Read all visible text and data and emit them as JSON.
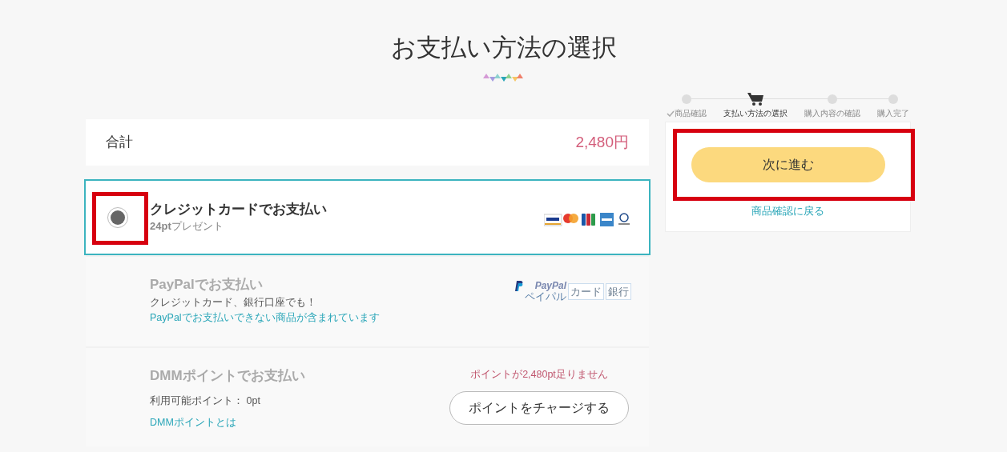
{
  "title": "お支払い方法の選択",
  "total": {
    "label": "合計",
    "amount": "2,480円"
  },
  "payment_methods": [
    {
      "kind": "card",
      "title": "クレジットカードでお支払い",
      "selected": true,
      "disabled": false,
      "highlighted": true,
      "bonus": "**24pt**プレゼント"
    },
    {
      "kind": "paypal",
      "title": "PayPalでお支払い",
      "selected": false,
      "disabled": true,
      "highlighted": false,
      "note": "クレジットカード、銀行口座でも！",
      "link": "PayPalでお支払いできない商品が含まれています",
      "logo": {
        "name": "PayPal",
        "reading": "ペイパル",
        "tags": [
          "カード",
          "銀行"
        ]
      }
    },
    {
      "kind": "points",
      "title": "DMMポイントでお支払い",
      "selected": false,
      "disabled": true,
      "highlighted": false,
      "note": "利用可能ポイント：  0pt",
      "link": "DMMポイントとは",
      "warning": "ポイントが2,480pt足りません",
      "button": "ポイントをチャージする"
    }
  ],
  "steps": [
    {
      "label": "商品確認",
      "completed": true,
      "selected": false
    },
    {
      "label": "支払い方法の選択",
      "completed": false,
      "selected": true
    },
    {
      "label": "購入内容の確認",
      "completed": false,
      "selected": false
    },
    {
      "label": "購入完了",
      "completed": false,
      "selected": false
    }
  ],
  "sidebar": {
    "next_button": "次に進む",
    "next_highlighted": true,
    "back_link": "商品確認に戻る"
  }
}
